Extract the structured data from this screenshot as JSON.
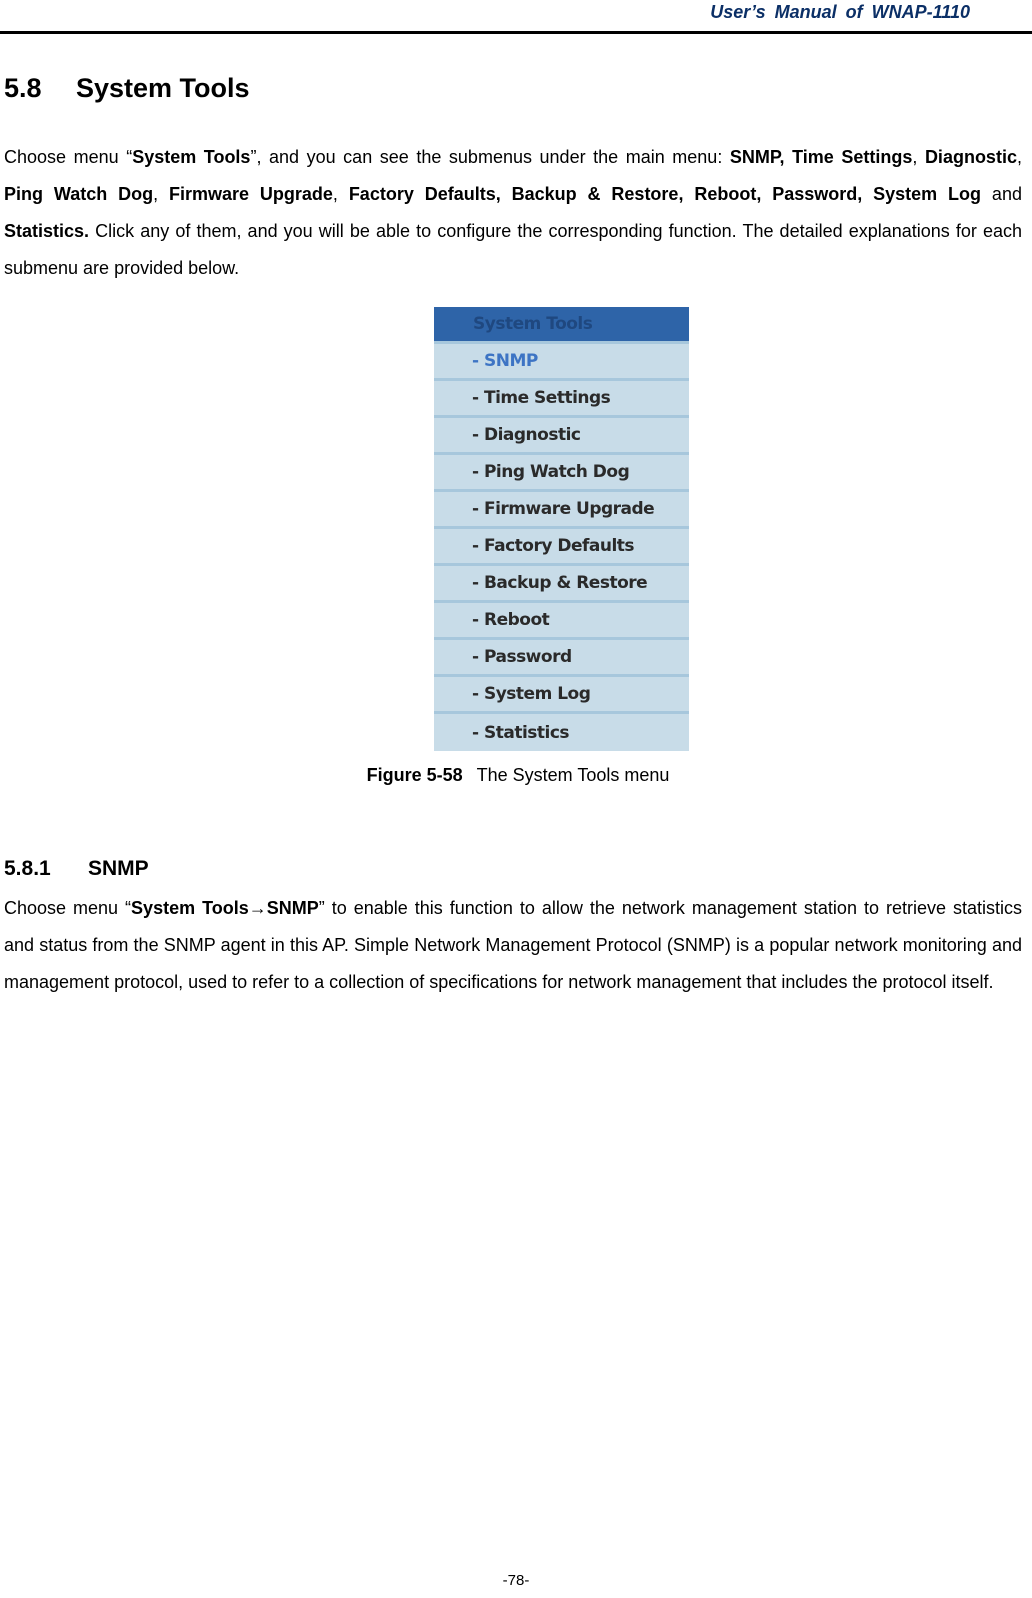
{
  "header": {
    "title": "User’s  Manual  of  WNAP-1110"
  },
  "section": {
    "number": "5.8",
    "title": "System Tools",
    "intro": {
      "t1": "Choose menu “",
      "b1": "System Tools",
      "t2": "”, and you can see the submenus under the main menu: ",
      "b2": "SNMP, Time Settings",
      "t3": ", ",
      "b3": "Diagnostic",
      "t4": ", ",
      "b4": "Ping Watch Dog",
      "t5": ", ",
      "b5": "Firmware Upgrade",
      "t6": ", ",
      "b6": "Factory Defaults, Backup & Restore, Reboot, Password, System Log",
      "t7": " and ",
      "b7": "Statistics.",
      "t8": " Click any of them, and you will be able to configure the corresponding function. The detailed explanations for each submenu are provided below."
    }
  },
  "figure": {
    "menu_header": "System Tools",
    "items": [
      {
        "label": "- SNMP",
        "active": true
      },
      {
        "label": "- Time Settings",
        "active": false
      },
      {
        "label": "- Diagnostic",
        "active": false
      },
      {
        "label": "- Ping Watch Dog",
        "active": false
      },
      {
        "label": "- Firmware Upgrade",
        "active": false
      },
      {
        "label": "- Factory Defaults",
        "active": false
      },
      {
        "label": "- Backup & Restore",
        "active": false
      },
      {
        "label": "- Reboot",
        "active": false
      },
      {
        "label": "- Password",
        "active": false
      },
      {
        "label": "- System Log",
        "active": false
      },
      {
        "label": "- Statistics",
        "active": false
      }
    ],
    "caption_label": "Figure 5-58",
    "caption_text": "The System Tools menu",
    "colors": {
      "header_bg": "#2e64a8",
      "item_bg": "#c8dce8",
      "separator": "#a7c7dc",
      "active_text": "#3d74c4"
    }
  },
  "subsection": {
    "number": "5.8.1",
    "title": "SNMP",
    "body": {
      "t1": "Choose menu “",
      "b1": "System Tools→SNMP",
      "t2": "” to enable this function to allow the network management station to retrieve statistics and status from the SNMP agent in this AP. Simple Network Management Protocol (SNMP) is a popular network monitoring and management protocol, used to refer to a collection of specifications for network management that includes the protocol itself."
    }
  },
  "footer": {
    "page_number": "-78-"
  }
}
